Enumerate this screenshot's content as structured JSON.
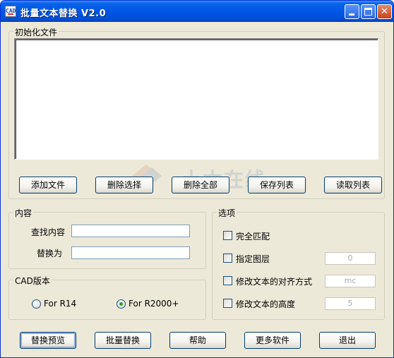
{
  "window": {
    "title": "批量文本替换 V2.0",
    "titlebar_color": "#0054e3",
    "icon": "app-icon",
    "icon_text": "CAD"
  },
  "file_group": {
    "legend": "初始化文件",
    "buttons": {
      "add_file": "添加文件",
      "delete_selected": "删除选择",
      "delete_all": "删除全部",
      "save_list": "保存列表",
      "read_list": "读取列表"
    }
  },
  "content_group": {
    "legend": "内容",
    "find_label": "查找内容",
    "find_value": "",
    "replace_label": "替换为",
    "replace_value": ""
  },
  "cad_group": {
    "legend": "CAD版本",
    "options": [
      "For R14",
      "For R2000+"
    ],
    "selected": "For R2000+"
  },
  "options_group": {
    "legend": "选项",
    "items": [
      {
        "label": "完全匹配",
        "checked": false
      },
      {
        "label": "指定图层",
        "checked": false,
        "value": "0"
      },
      {
        "label": "修改文本的对齐方式",
        "checked": false,
        "value": "mc"
      },
      {
        "label": "修改文本的高度",
        "checked": false,
        "value": "5"
      }
    ]
  },
  "bottom_buttons": {
    "preview": "替换预览",
    "batch_replace": "批量替换",
    "help": "帮助",
    "more_software": "更多软件",
    "exit": "退出"
  },
  "watermark": {
    "text": "土木在线"
  }
}
